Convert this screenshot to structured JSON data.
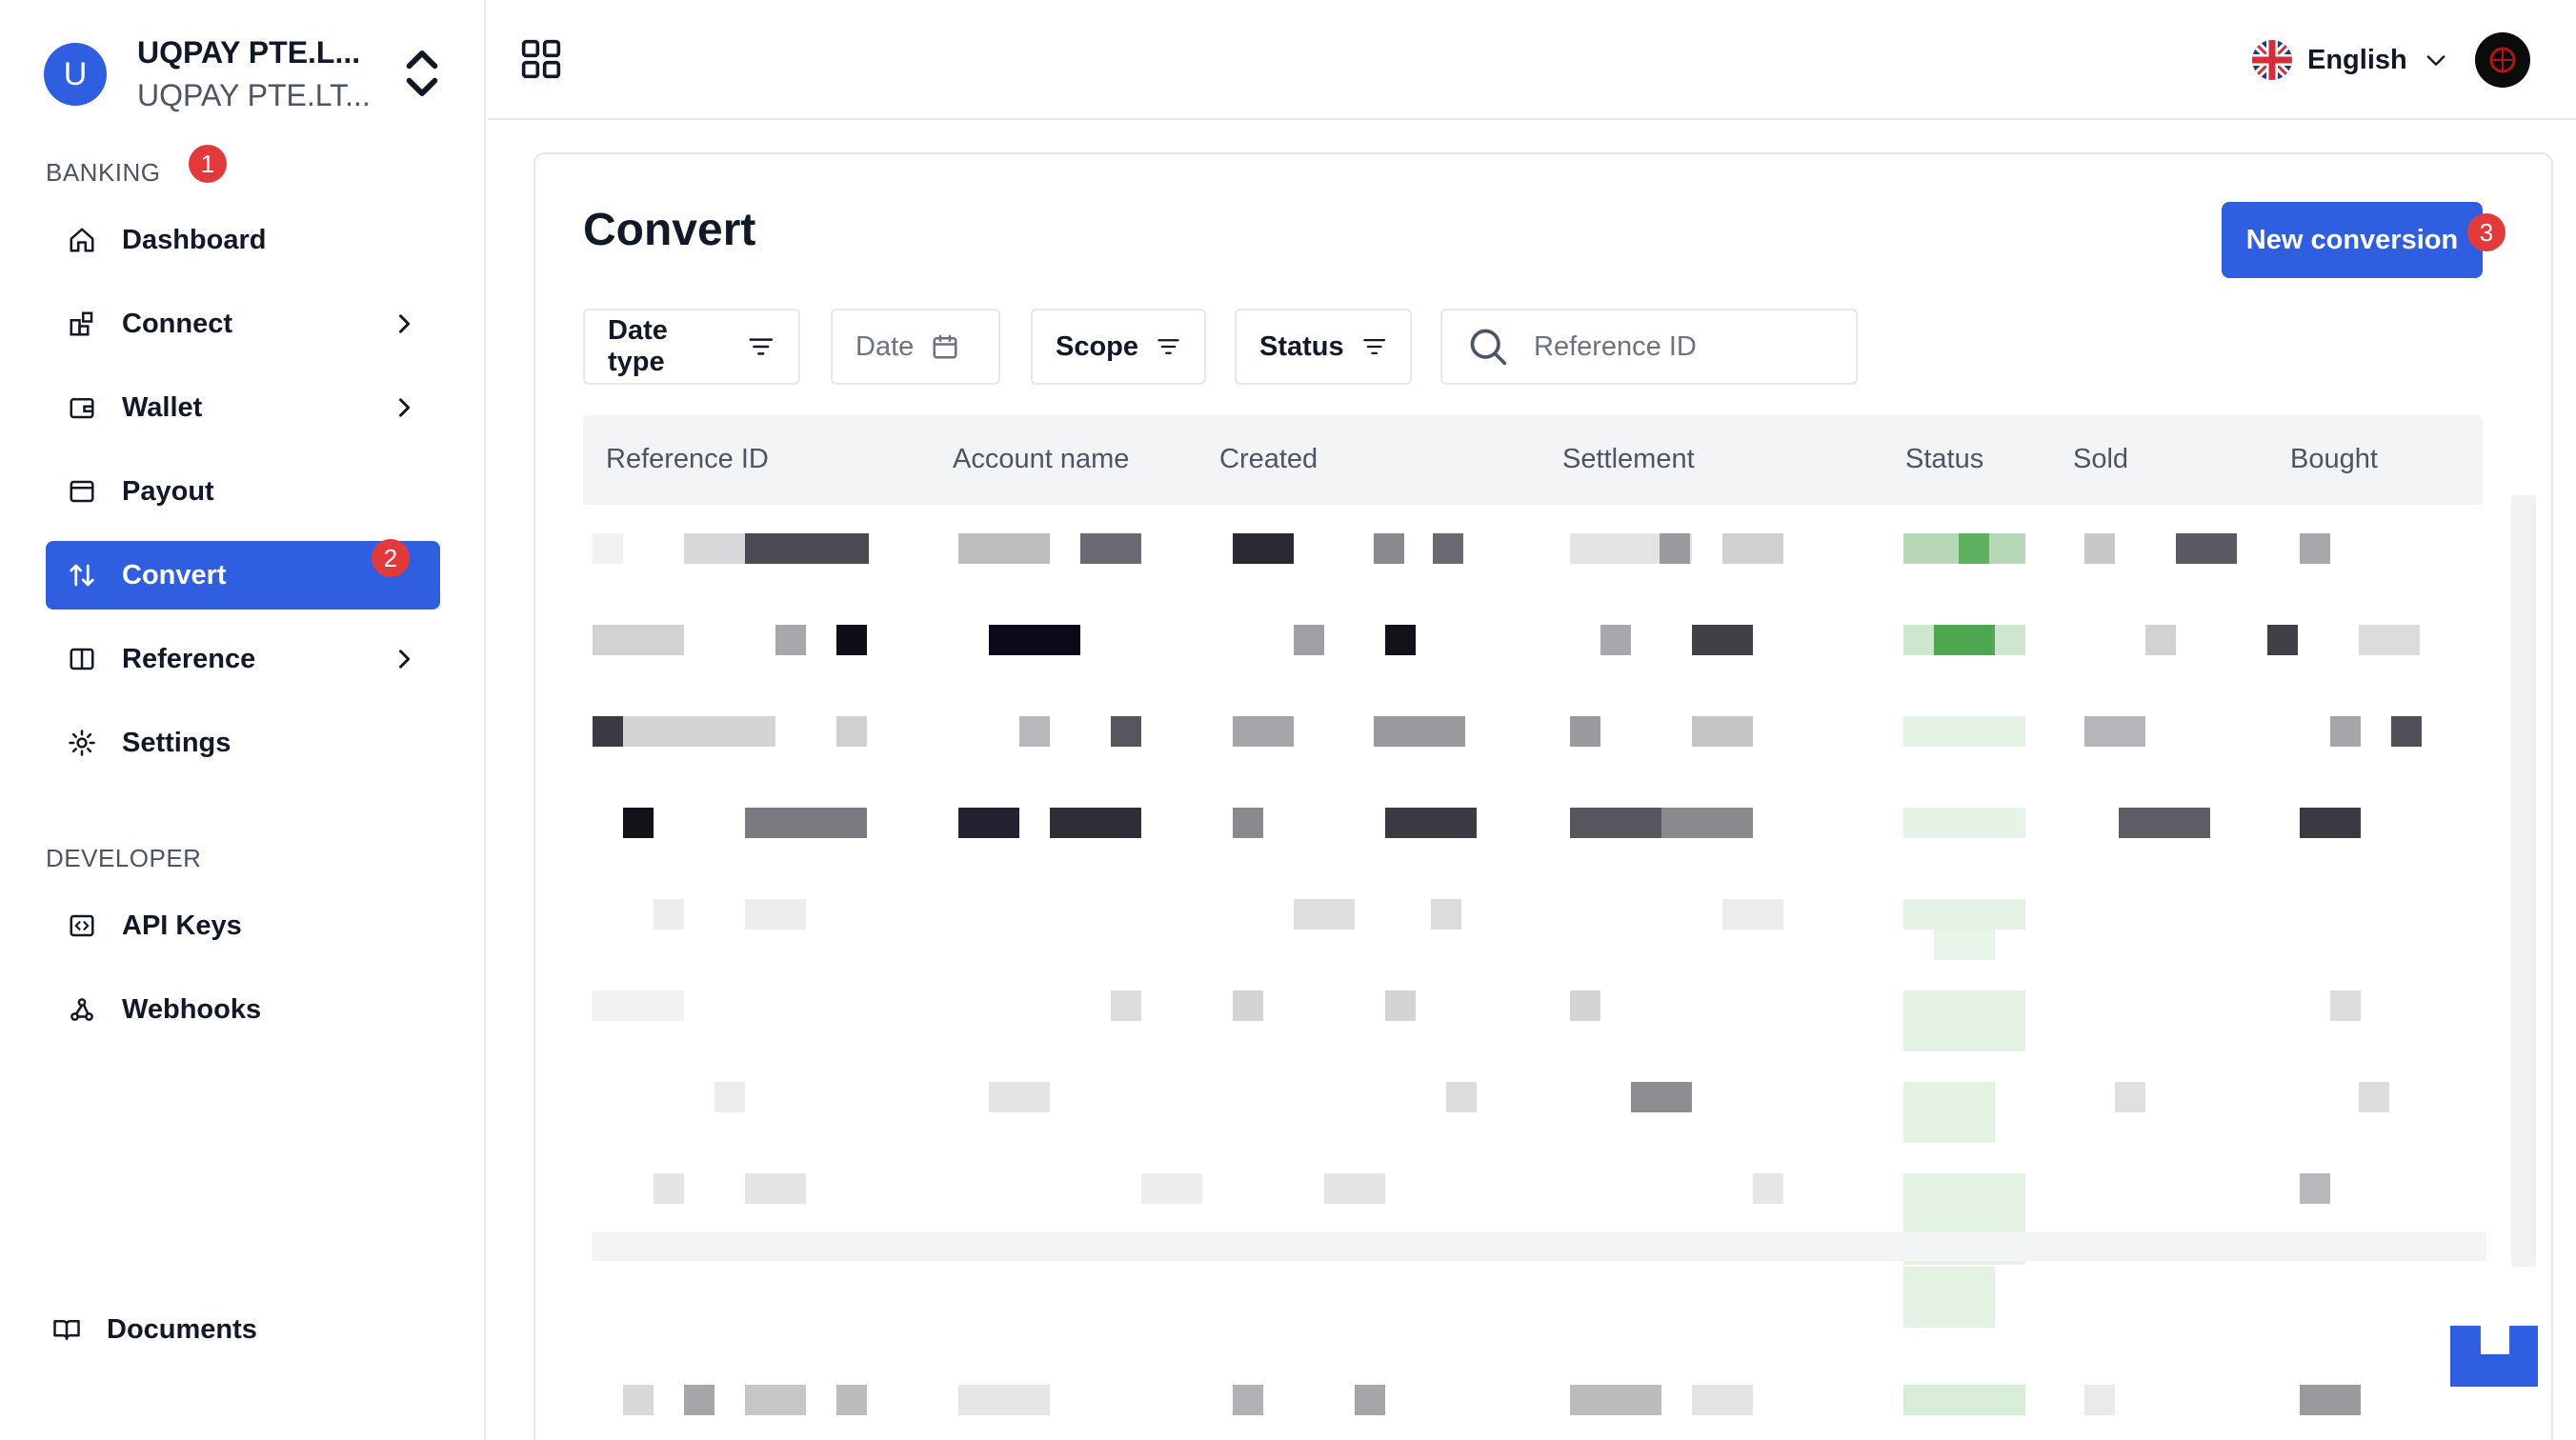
{
  "org": {
    "avatar_letter": "U",
    "name": "UQPAY PTE.L...",
    "sub": "UQPAY PTE.LT..."
  },
  "sidebar": {
    "banking_label": "BANKING",
    "banking_badge": "1",
    "developer_label": "DEVELOPER",
    "items": [
      {
        "label": "Dashboard",
        "icon": "home-icon"
      },
      {
        "label": "Connect",
        "icon": "connect-icon"
      },
      {
        "label": "Wallet",
        "icon": "wallet-icon"
      },
      {
        "label": "Payout",
        "icon": "payout-icon"
      },
      {
        "label": "Convert",
        "icon": "convert-icon",
        "active": true,
        "badge": "2"
      },
      {
        "label": "Reference",
        "icon": "book-icon"
      },
      {
        "label": "Settings",
        "icon": "gear-icon"
      }
    ],
    "dev_items": [
      {
        "label": "API Keys",
        "icon": "code-icon"
      },
      {
        "label": "Webhooks",
        "icon": "webhook-icon"
      }
    ],
    "documents_label": "Documents"
  },
  "topbar": {
    "language": "English"
  },
  "page": {
    "title": "Convert",
    "new_button": "New conversion",
    "new_badge": "3",
    "filters": {
      "date_type": "Date type",
      "date": "Date",
      "scope": "Scope",
      "status": "Status"
    },
    "search_placeholder": "Reference ID"
  },
  "table": {
    "columns": [
      "Reference ID",
      "Account name",
      "Created",
      "Settlement",
      "Status",
      "Sold",
      "Bought"
    ]
  },
  "colors": {
    "accent": "#2f5ee0",
    "badge": "#e23a3a"
  }
}
